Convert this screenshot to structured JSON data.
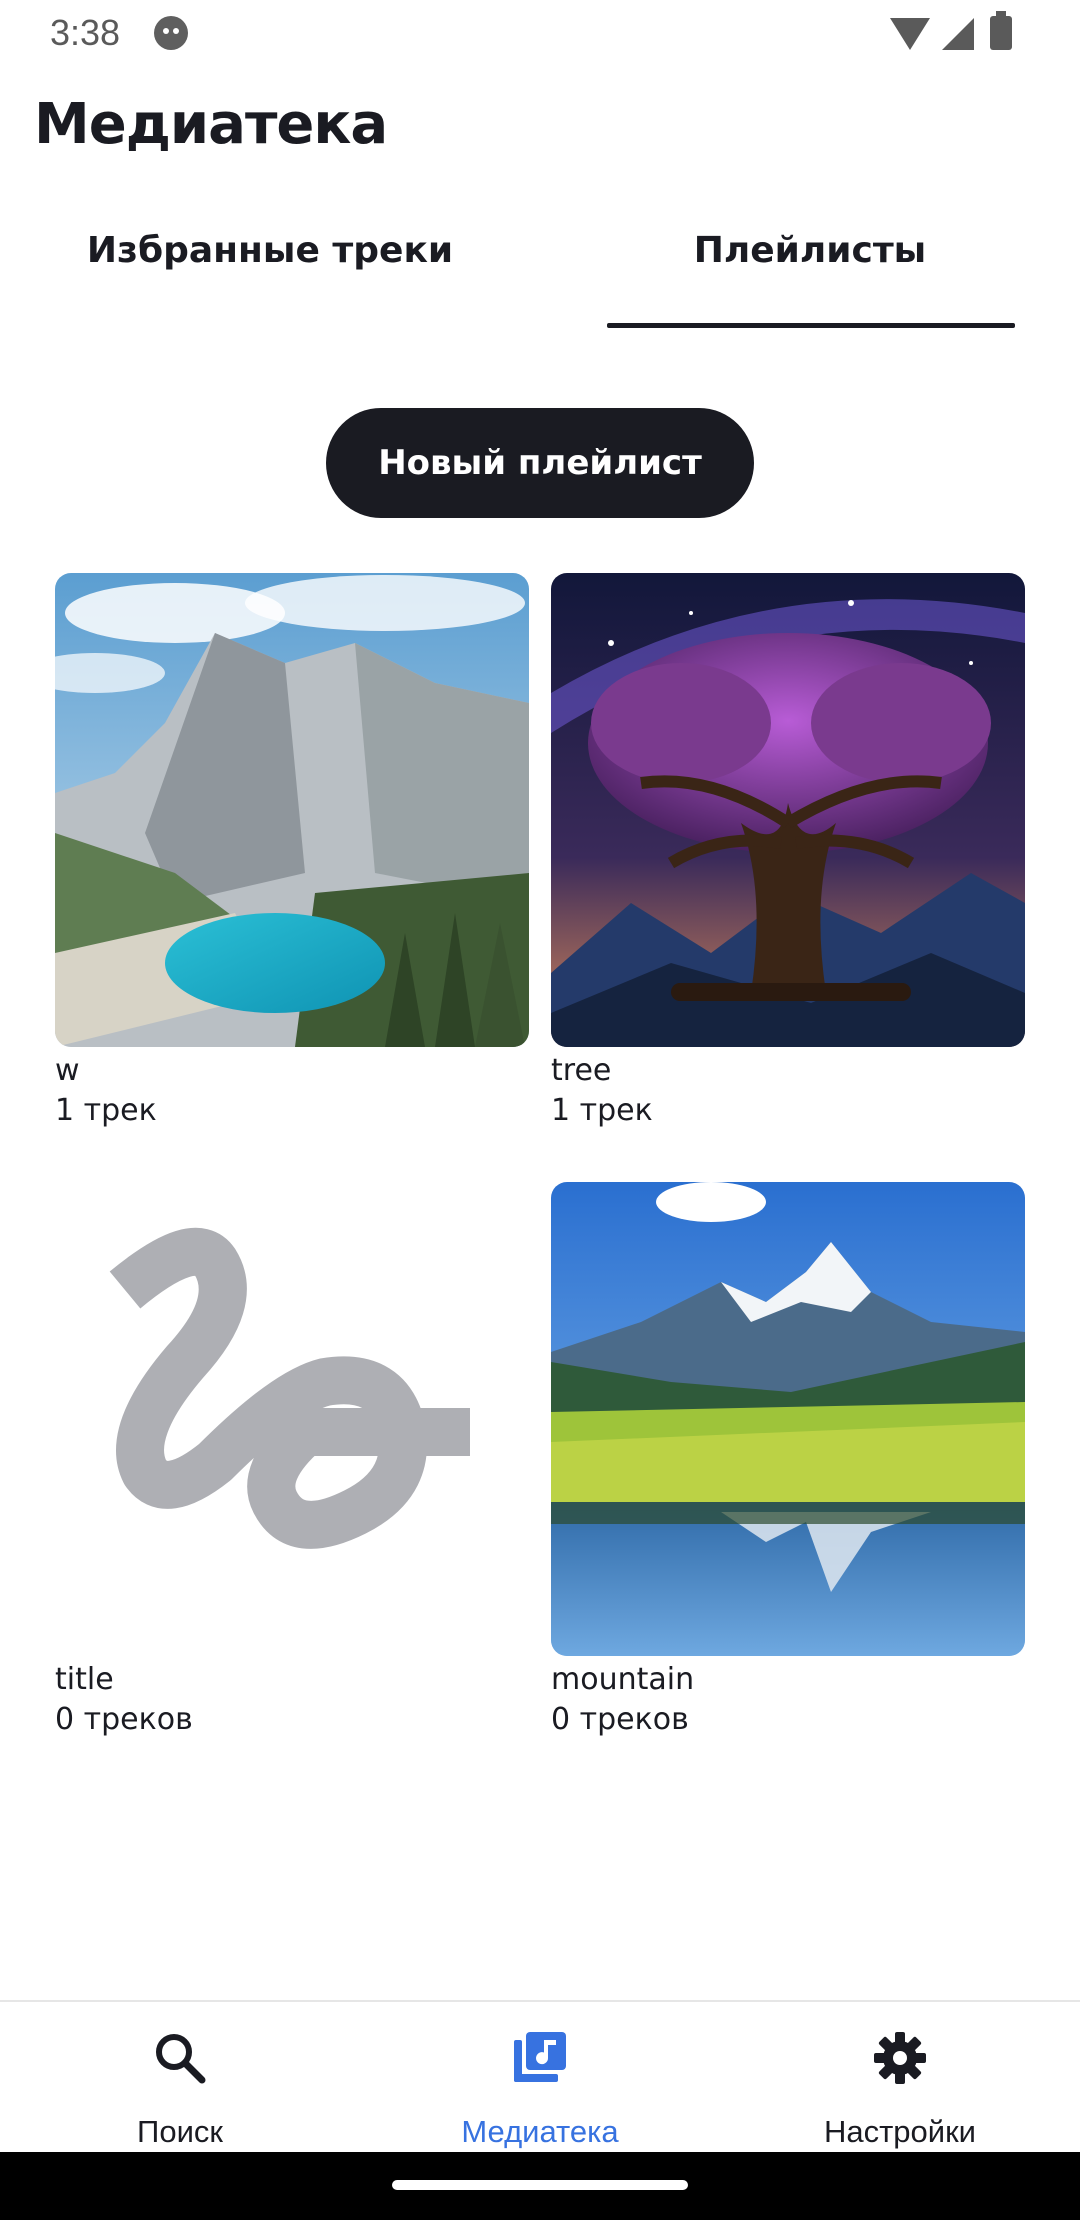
{
  "status_bar": {
    "time": "3:38"
  },
  "page_title": "Медиатека",
  "tabs": [
    {
      "label": "Избранные треки",
      "selected": false
    },
    {
      "label": "Плейлисты",
      "selected": true
    }
  ],
  "new_playlist_label": "Новый плейлист",
  "playlists": [
    {
      "name": "w",
      "count": "1 трек",
      "cover": "mountain-lake-photo"
    },
    {
      "name": "tree",
      "count": "1 трек",
      "cover": "cosmic-tree-art"
    },
    {
      "name": "title",
      "count": "0 треков",
      "cover": "placeholder-squiggle-icon"
    },
    {
      "name": "mountain",
      "count": "0 треков",
      "cover": "alpine-meadow-photo"
    }
  ],
  "bottom_nav": [
    {
      "label": "Поиск",
      "icon": "search-icon",
      "active": false
    },
    {
      "label": "Медиатека",
      "icon": "media-library-icon",
      "active": true
    },
    {
      "label": "Настройки",
      "icon": "gear-icon",
      "active": false
    }
  ],
  "colors": {
    "primary_dark": "#1a1b22",
    "accent_blue": "#3772e0",
    "placeholder_gray": "#aeafb4"
  }
}
